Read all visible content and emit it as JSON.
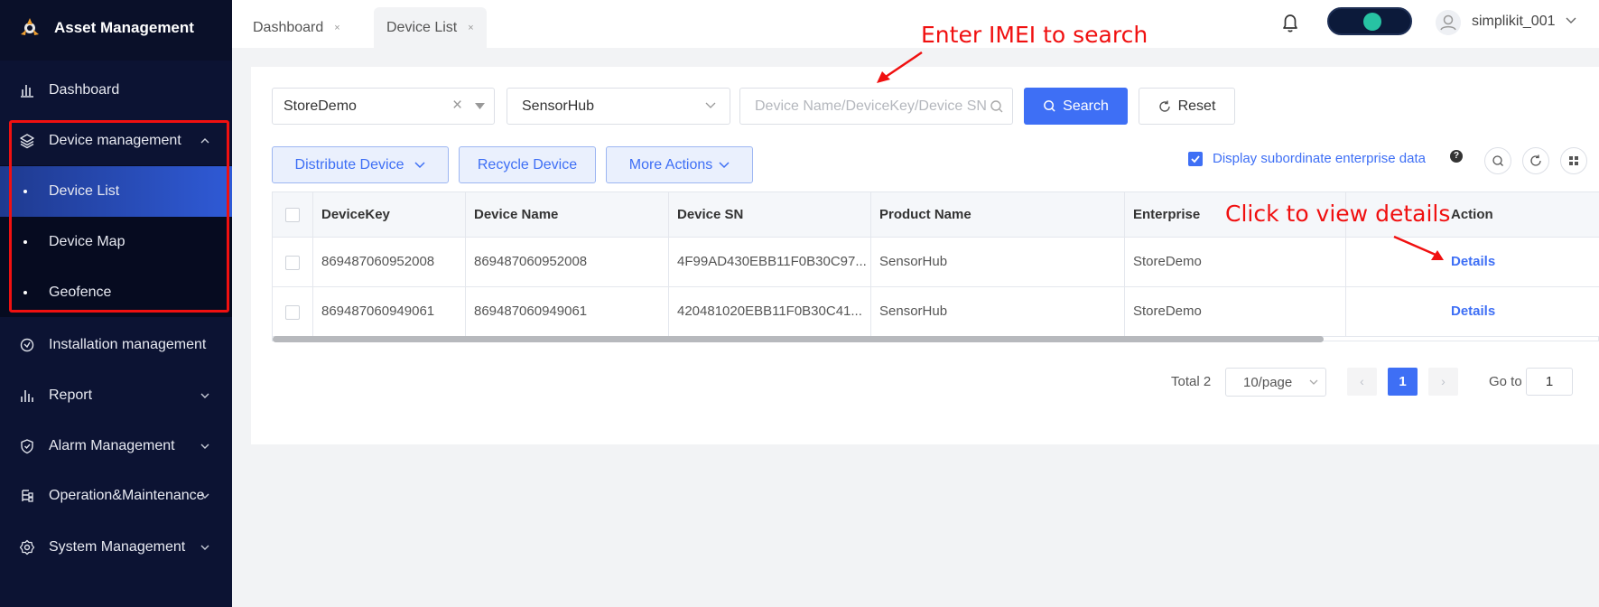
{
  "app": {
    "title": "Asset Management"
  },
  "sidebar": {
    "items": [
      {
        "label": "Dashboard",
        "icon": "bar-chart-icon"
      },
      {
        "label": "Device management",
        "icon": "layers-icon"
      },
      {
        "label": "Installation management",
        "icon": "install-icon"
      },
      {
        "label": "Report",
        "icon": "report-icon"
      },
      {
        "label": "Alarm Management",
        "icon": "shield-check-icon"
      },
      {
        "label": "Operation&Maintenance",
        "icon": "maintenance-icon"
      },
      {
        "label": "System Management",
        "icon": "gear-icon"
      }
    ],
    "sub_items": [
      {
        "label": "Device List"
      },
      {
        "label": "Device Map"
      },
      {
        "label": "Geofence"
      }
    ]
  },
  "tabs": [
    {
      "label": "Dashboard",
      "close": "×"
    },
    {
      "label": "Device List",
      "close": "×"
    }
  ],
  "header": {
    "username": "simplikit_001"
  },
  "filters": {
    "enterprise": "StoreDemo",
    "clear_icon": "×",
    "product": "SensorHub",
    "search_placeholder": "Device Name/DeviceKey/Device SN",
    "search_label": "Search",
    "reset_label": "Reset"
  },
  "actions": {
    "distribute": "Distribute Device",
    "recycle": "Recycle Device",
    "more": "More Actions",
    "display_subordinate": "Display subordinate enterprise data",
    "help": "?"
  },
  "table": {
    "columns": [
      "DeviceKey",
      "Device Name",
      "Device SN",
      "Product Name",
      "Enterprise",
      "Action"
    ],
    "rows": [
      {
        "devicekey": "869487060952008",
        "device_name": "869487060952008",
        "device_sn": "4F99AD430EBB11F0B30C97...",
        "product_name": "SensorHub",
        "enterprise": "StoreDemo",
        "action": "Details"
      },
      {
        "devicekey": "869487060949061",
        "device_name": "869487060949061",
        "device_sn": "420481020EBB11F0B30C41...",
        "product_name": "SensorHub",
        "enterprise": "StoreDemo",
        "action": "Details"
      }
    ]
  },
  "pagination": {
    "total": "Total 2",
    "page_size": "10/page",
    "prev": "‹",
    "next": "›",
    "current": "1",
    "goto_label": "Go to",
    "goto_value": "1"
  },
  "annotations": {
    "search_hint": "Enter IMEI to search",
    "details_hint": "Click to view details"
  },
  "colors": {
    "sidebar_bg": "#0c1333",
    "primary": "#3e6ff5",
    "annotation": "#f01010"
  }
}
